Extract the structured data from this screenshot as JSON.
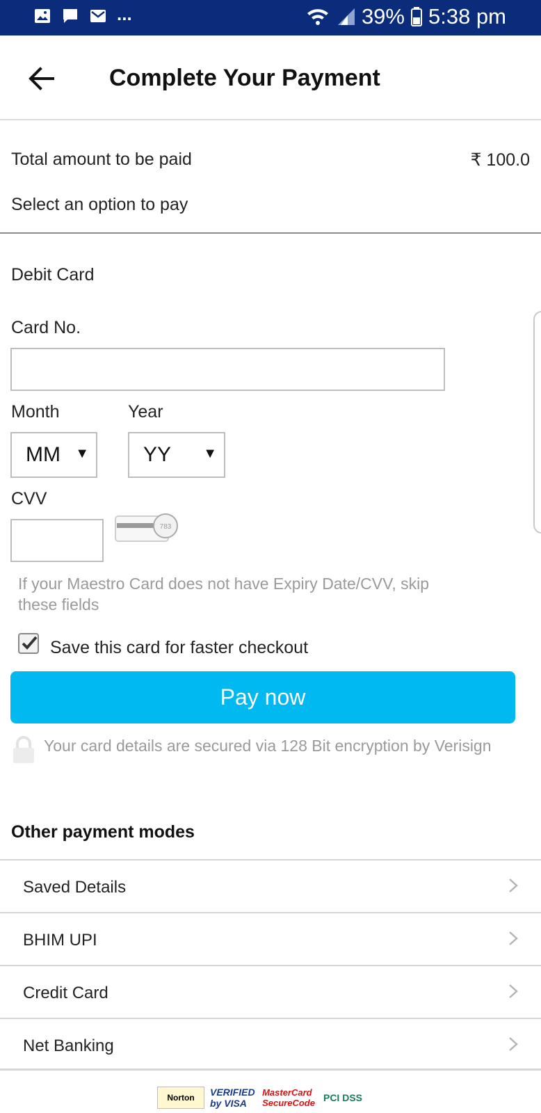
{
  "status_bar": {
    "dots": "...",
    "battery": "39%",
    "time": "5:38 pm"
  },
  "header": {
    "title": "Complete Your Payment"
  },
  "summary": {
    "total_label": "Total amount to be paid",
    "total_amount": "₹ 100.0",
    "select_prompt": "Select an option to pay"
  },
  "card_form": {
    "card_type": "Debit Card",
    "card_no_label": "Card No.",
    "card_no_value": "",
    "month_label": "Month",
    "month_value": "MM",
    "year_label": "Year",
    "year_value": "YY",
    "cvv_label": "CVV",
    "cvv_value": "",
    "cvv_hint_number": "783",
    "maestro_note": "If your Maestro Card does not have Expiry Date/CVV, skip these fields",
    "save_card_label": "Save this card for faster checkout",
    "save_card_checked": true,
    "pay_button": "Pay now",
    "secure_note": "Your card details are secured via 128 Bit encryption by Verisign"
  },
  "other_modes": {
    "title": "Other payment modes",
    "items": [
      {
        "label": "Saved Details"
      },
      {
        "label": "BHIM UPI"
      },
      {
        "label": "Credit Card"
      },
      {
        "label": "Net Banking"
      }
    ]
  },
  "badges": {
    "norton": "Norton",
    "visa": "VERIFIED by VISA",
    "mastercard": "MasterCard SecureCode",
    "pci": "PCI DSS"
  },
  "colors": {
    "status_bar": "#0b2c7a",
    "pay_button": "#00b9f1",
    "muted_text": "#9a9a9a"
  }
}
